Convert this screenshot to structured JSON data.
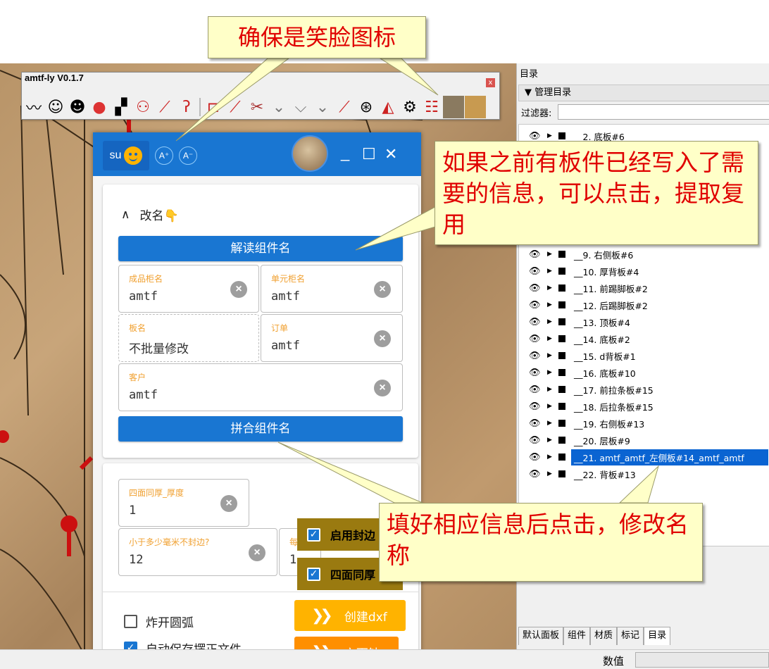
{
  "toolbar": {
    "title": "amtf-ly V0.1.7",
    "close": "x",
    "icons": [
      "face-icon",
      "smile-icon",
      "grin-icon",
      "tomato-icon",
      "blocks-icon",
      "bike-icon",
      "pin-icon",
      "hook-icon",
      "bracket-icon",
      "marker-icon",
      "cut-icon",
      "floor-icon",
      "angle-icon",
      "light-icon",
      "slope-icon",
      "drill-icon",
      "knife-icon",
      "gear-icon",
      "checklist-icon",
      "photo-icon",
      "buddha-icon"
    ]
  },
  "dialog": {
    "su_label": "su",
    "font_up": "A⁺",
    "font_down": "A⁻",
    "rename_header": "改名👇",
    "decode_button": "解读组件名",
    "combine_button": "拼合组件名",
    "fields": {
      "product_cabinet": {
        "label": "成品柜名",
        "value": "amtf"
      },
      "unit_cabinet": {
        "label": "单元柜名",
        "value": "amtf"
      },
      "board_name": {
        "label": "板名",
        "value": "不批量修改"
      },
      "order": {
        "label": "订单",
        "value": "amtf"
      },
      "customer": {
        "label": "客户",
        "value": "amtf"
      },
      "thickness": {
        "label": "四面同厚_厚度",
        "value": "1"
      },
      "no_seal": {
        "label": "小于多少毫米不封边?",
        "value": "12"
      },
      "each_prefix": {
        "label": "每",
        "value": "1"
      }
    },
    "enable_seal": "启用封边",
    "four_same": "四面同厚",
    "explode_arc": "炸开圆弧",
    "autosave": "自动保存摆正文件",
    "create_dxf": "创建dxf",
    "six_drill": "六面钻"
  },
  "panel": {
    "title": "目录",
    "section": "▼ 管理目录",
    "filter_label": "过滤器:",
    "items": [
      "__2. 底板#6",
      "__9. 右侧板#6",
      "__10. 厚背板#4",
      "__11. 前踢脚板#2",
      "__12. 后踢脚板#2",
      "__13. 顶板#4",
      "__14. 底板#2",
      "__15. d背板#1",
      "__16. 底板#10",
      "__17. 前拉条板#15",
      "__18. 后拉条板#15",
      "__19. 右侧板#13",
      "__20. 层板#9",
      "__21. amtf_amtf_左侧板#14_amtf_amtf",
      "__22. 背板#13"
    ],
    "tabs": [
      "默认面板",
      "组件",
      "材质",
      "标记",
      "目录"
    ]
  },
  "status": {
    "label": "数值"
  },
  "callouts": {
    "c1": "确保是笑脸图标",
    "c2": "如果之前有板件已经写入了需要的信息，可以点击，提取复用",
    "c3": "填好相应信息后点击，修改名称"
  }
}
